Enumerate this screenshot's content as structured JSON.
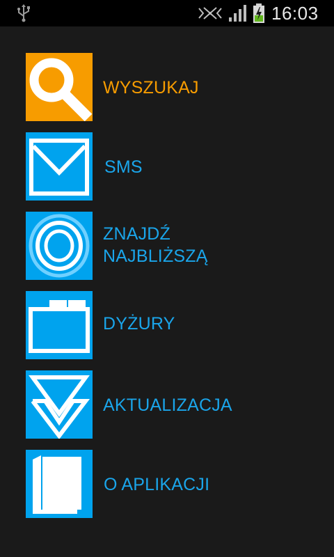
{
  "status_bar": {
    "time": "16:03",
    "icons": [
      "usb-icon",
      "no-sim-icon",
      "signal-icon",
      "battery-charging-icon"
    ]
  },
  "colors": {
    "background": "#1a1a1a",
    "tile_blue": "#00a3ee",
    "tile_orange": "#f79c00",
    "label_blue": "#1aa5ea",
    "label_orange": "#f79c00"
  },
  "menu": {
    "items": [
      {
        "label": "WYSZUKAJ",
        "icon": "magnifier-icon",
        "active": true
      },
      {
        "label": "SMS",
        "icon": "envelope-icon",
        "active": false
      },
      {
        "label": "ZNAJDŹ\nNAJBLIŻSZĄ",
        "icon": "target-icon",
        "active": false
      },
      {
        "label": "DYŻURY",
        "icon": "calendar-folder-icon",
        "active": false
      },
      {
        "label": "AKTUALIZACJA",
        "icon": "download-arrow-icon",
        "active": false
      },
      {
        "label": "O APLIKACJI",
        "icon": "pages-icon",
        "active": false
      }
    ]
  }
}
